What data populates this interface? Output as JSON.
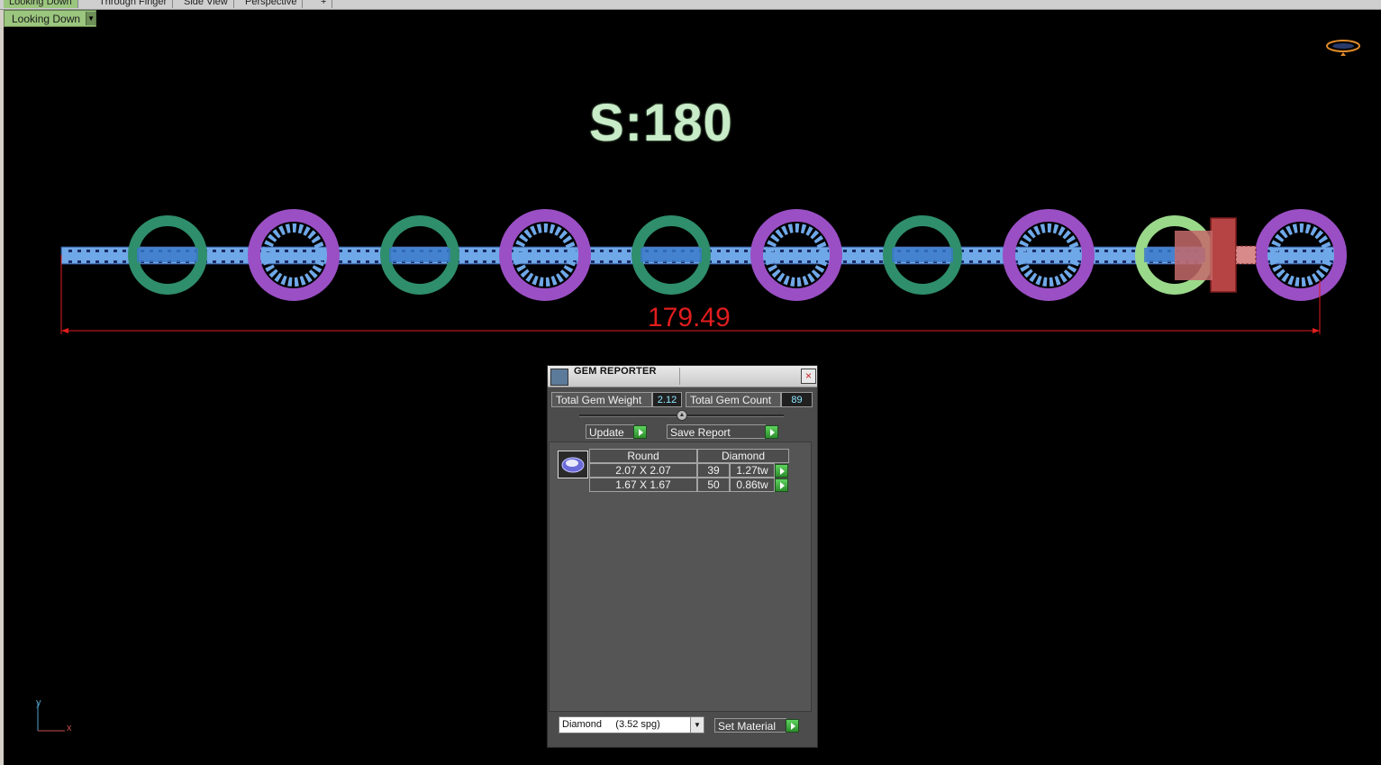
{
  "tabs": [
    "Looking Down",
    "Through Finger",
    "Side View",
    "Perspective",
    "+"
  ],
  "viewport": {
    "view_selector": "Looking Down",
    "scale_label": "S:180",
    "dimension_label": "179.49",
    "axis": {
      "y": "y",
      "x": "x"
    }
  },
  "gem_reporter": {
    "title": "GEM REPORTER",
    "close": "×",
    "total_weight_label": "Total Gem Weight",
    "total_weight_value": "2.12",
    "total_count_label": "Total Gem Count",
    "total_count_value": "89",
    "update_label": "Update",
    "save_report_label": "Save Report",
    "table": {
      "shape": "Round",
      "material": "Diamond",
      "rows": [
        {
          "size": "2.07 X 2.07",
          "count": "39",
          "weight": "1.27tw"
        },
        {
          "size": "1.67 X 1.67",
          "count": "50",
          "weight": "0.86tw"
        }
      ]
    },
    "material_select": "Diamond     (3.52 spg)",
    "set_material_label": "Set Material"
  },
  "colors": {
    "viewport_bg": "#000000",
    "link_blue": "#6fa8e8",
    "ring_green": "#2f8e6c",
    "ring_purple": "#9a4fc4",
    "clasp_red": "#c04848",
    "dimension_red": "#e01d1d",
    "scale_text": "#c8ecc8"
  }
}
